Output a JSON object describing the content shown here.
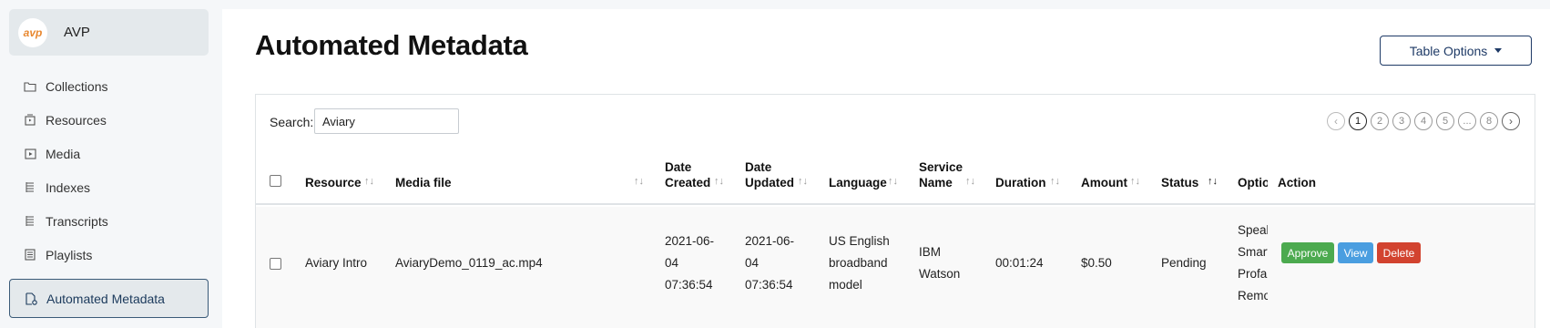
{
  "brand": {
    "logo_text": "avp",
    "name": "AVP"
  },
  "sidebar": {
    "items": [
      {
        "label": "Collections",
        "icon": "folder-icon"
      },
      {
        "label": "Resources",
        "icon": "resource-icon"
      },
      {
        "label": "Media",
        "icon": "media-icon"
      },
      {
        "label": "Indexes",
        "icon": "index-icon"
      },
      {
        "label": "Transcripts",
        "icon": "transcript-icon"
      },
      {
        "label": "Playlists",
        "icon": "playlist-icon"
      },
      {
        "label": "Automated Metadata",
        "icon": "automated-metadata-icon",
        "active": true
      }
    ]
  },
  "page": {
    "title": "Automated Metadata"
  },
  "toolbar": {
    "table_options_label": "Table Options"
  },
  "search": {
    "label": "Search:",
    "value": "Aviary"
  },
  "pagination": {
    "prev": "‹",
    "pages": [
      "1",
      "2",
      "3",
      "4",
      "5",
      "...",
      "8"
    ],
    "current": "1",
    "next": "›"
  },
  "table": {
    "headers": {
      "resource": "Resource",
      "media_file": "Media file",
      "date_created_1": "Date",
      "date_created_2": "Created",
      "date_updated_1": "Date",
      "date_updated_2": "Updated",
      "language": "Language",
      "service_name_1": "Service",
      "service_name_2": "Name",
      "duration": "Duration",
      "amount": "Amount",
      "status": "Status",
      "options": "Options",
      "action": "Action"
    },
    "sort_icon": "↑↓",
    "rows": [
      {
        "resource": "Aviary Intro",
        "media_file": "AviaryDemo_0119_ac.mp4",
        "date_created": [
          "2021-06-",
          "04",
          "07:36:54"
        ],
        "date_updated": [
          "2021-06-",
          "04",
          "07:36:54"
        ],
        "language": [
          "US English",
          "broadband",
          "model"
        ],
        "service_name": [
          "IBM",
          "Watson"
        ],
        "duration": "00:01:24",
        "amount": "$0.50",
        "status": "Pending",
        "options": [
          "Speaker",
          "Smart",
          "Profanity",
          "Remove"
        ],
        "actions": {
          "approve": "Approve",
          "view": "View",
          "delete": "Delete"
        }
      }
    ]
  },
  "colors": {
    "approve": "#4caa4f",
    "view": "#4a9ee0",
    "delete": "#d2432f",
    "primary_outline": "#1e3a66"
  }
}
